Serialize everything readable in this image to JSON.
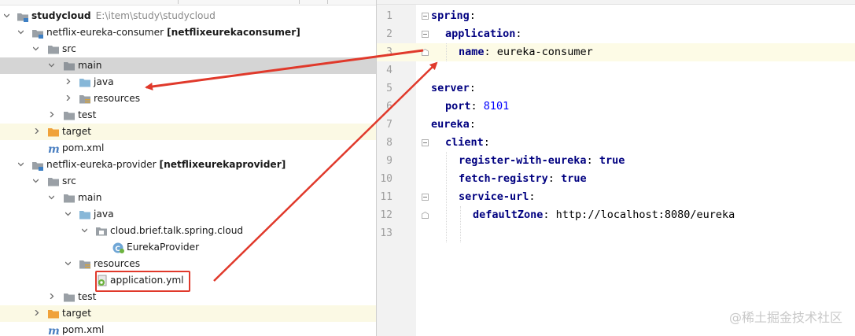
{
  "tree": {
    "rows": [
      {
        "label": "studycloud",
        "path": "E:\\item\\study\\studycloud"
      },
      {
        "label": "netflix-eureka-consumer",
        "module": "[netflixeurekaconsumer]"
      },
      {
        "label": "src"
      },
      {
        "label": "main"
      },
      {
        "label": "java"
      },
      {
        "label": "resources"
      },
      {
        "label": "test"
      },
      {
        "label": "target"
      },
      {
        "label": "pom.xml"
      },
      {
        "label": "netflix-eureka-provider",
        "module": "[netflixeurekaprovider]"
      },
      {
        "label": "src"
      },
      {
        "label": "main"
      },
      {
        "label": "java"
      },
      {
        "label": "cloud.brief.talk.spring.cloud"
      },
      {
        "label": "EurekaProvider"
      },
      {
        "label": "resources"
      },
      {
        "label": "application.yml"
      },
      {
        "label": "test"
      },
      {
        "label": "target"
      },
      {
        "label": "pom.xml"
      }
    ]
  },
  "editor": {
    "line_numbers": [
      "1",
      "2",
      "3",
      "4",
      "5",
      "6",
      "7",
      "8",
      "9",
      "10",
      "11",
      "12",
      "13"
    ],
    "lines": [
      {
        "key": "spring",
        "sep": ":",
        "value": ""
      },
      {
        "key": "application",
        "sep": ":",
        "value": ""
      },
      {
        "key": "name",
        "sep": ":",
        "value": " eureka-consumer"
      },
      {
        "key": "",
        "sep": "",
        "value": ""
      },
      {
        "key": "server",
        "sep": ":",
        "value": ""
      },
      {
        "key": "port",
        "sep": ":",
        "value": " 8101"
      },
      {
        "key": "eureka",
        "sep": ":",
        "value": ""
      },
      {
        "key": "client",
        "sep": ":",
        "value": ""
      },
      {
        "key": "register-with-eureka",
        "sep": ":",
        "value": " true"
      },
      {
        "key": "fetch-registry",
        "sep": ":",
        "value": " true"
      },
      {
        "key": "service-url",
        "sep": ":",
        "value": ""
      },
      {
        "key": "defaultZone",
        "sep": ":",
        "value": " http://localhost:8080/eureka"
      },
      {
        "key": "",
        "sep": "",
        "value": ""
      }
    ]
  },
  "watermark": "@稀土掘金技术社区",
  "colors": {
    "selection": "#d5d5d5",
    "excluded_row": "#fbf9e4",
    "yaml_key": "#000080",
    "number": "#0000ff",
    "annotation_red": "#e0392b",
    "folder_blue": "#87b7d8",
    "folder_orange": "#f0a23a",
    "folder_grey": "#9aa0a6"
  }
}
